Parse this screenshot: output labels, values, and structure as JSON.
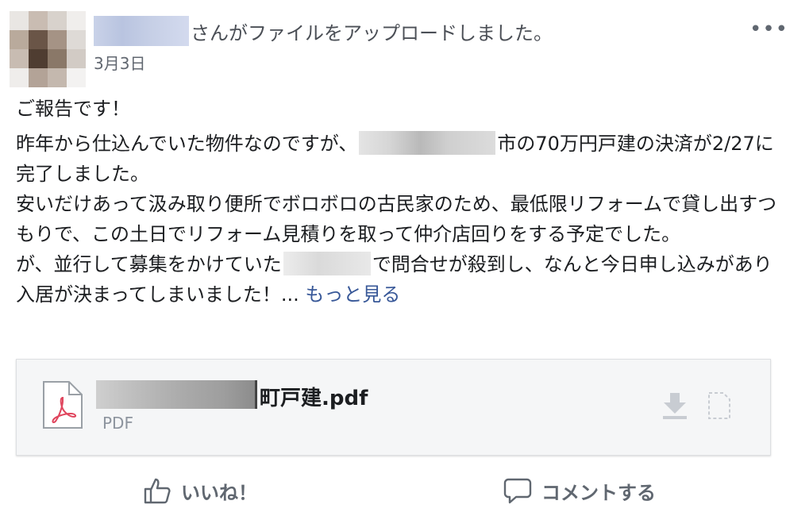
{
  "post": {
    "header_text": "さんがファイルをアップロードしました。",
    "date": "3月3日",
    "more_icon": "•••",
    "body": {
      "line1": "ご報告です！",
      "p2_a": "昨年から仕込んでいた物件なのですが、",
      "p2_b": "市の70万円戸建の決済が2/27に完了しました。",
      "p3": "安いだけあって汲み取り便所でボロボロの古民家のため、最低限リフォームで貸し出すつもりで、この土日でリフォーム見積りを取って仲介店回りをする予定でした。",
      "p4_a": "が、並行して募集をかけていた",
      "p4_b": "で問合せが殺到し、なんと今日申し込みがあり入居が決まってしまいました！...",
      "see_more": "もっと見る"
    }
  },
  "attachment": {
    "file_name": "町戸建.pdf",
    "file_type": "PDF",
    "icon": "pdf-file-icon",
    "download_icon": "download-icon",
    "preview_icon": "document-icon"
  },
  "actions": {
    "like_label": "いいね！",
    "comment_label": "コメントする",
    "like_icon": "thumbs-up-icon",
    "comment_icon": "comment-icon"
  },
  "colors": {
    "link": "#385898",
    "muted": "#606770",
    "pdf_red": "#e0465e"
  }
}
